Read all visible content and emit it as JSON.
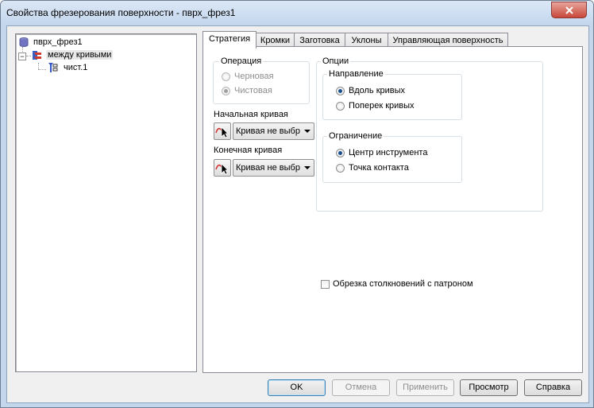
{
  "window": {
    "title": "Свойства фрезерования поверхности - пврх_фрез1"
  },
  "tree": {
    "items": [
      {
        "label": "пврх_фрез1",
        "icon": "database-icon"
      },
      {
        "label": "между кривыми",
        "icon": "surface-operation-icon"
      },
      {
        "label": "чист.1",
        "icon": "tool-pass-icon"
      }
    ]
  },
  "tabs": [
    "Стратегия",
    "Кромки",
    "Заготовка",
    "Уклоны",
    "Управляющая поверхность"
  ],
  "active_tab": "Стратегия",
  "operation": {
    "label": "Операция",
    "options": [
      "Черновая",
      "Чистовая"
    ],
    "selected": "Чистовая",
    "enabled": false
  },
  "start_curve": {
    "label": "Начальная кривая",
    "value": "Кривая не выбр"
  },
  "end_curve": {
    "label": "Конечная кривая",
    "value": "Кривая не выбр"
  },
  "options": {
    "label": "Опции",
    "direction": {
      "label": "Направление",
      "options": [
        "Вдоль кривых",
        "Поперек кривых"
      ],
      "selected": "Вдоль кривых"
    },
    "limit": {
      "label": "Ограничение",
      "options": [
        "Центр инструмента",
        "Точка контакта"
      ],
      "selected": "Центр инструмента"
    }
  },
  "collision_trim": {
    "label": "Обрезка столкновений с патроном",
    "checked": false
  },
  "buttons": {
    "ok": "OK",
    "cancel": "Отмена",
    "apply": "Применить",
    "preview": "Просмотр",
    "help": "Справка"
  },
  "colors": {
    "accent": "#1a4f8f",
    "title_bar": "#c4d7ee",
    "close": "#c8473a"
  }
}
